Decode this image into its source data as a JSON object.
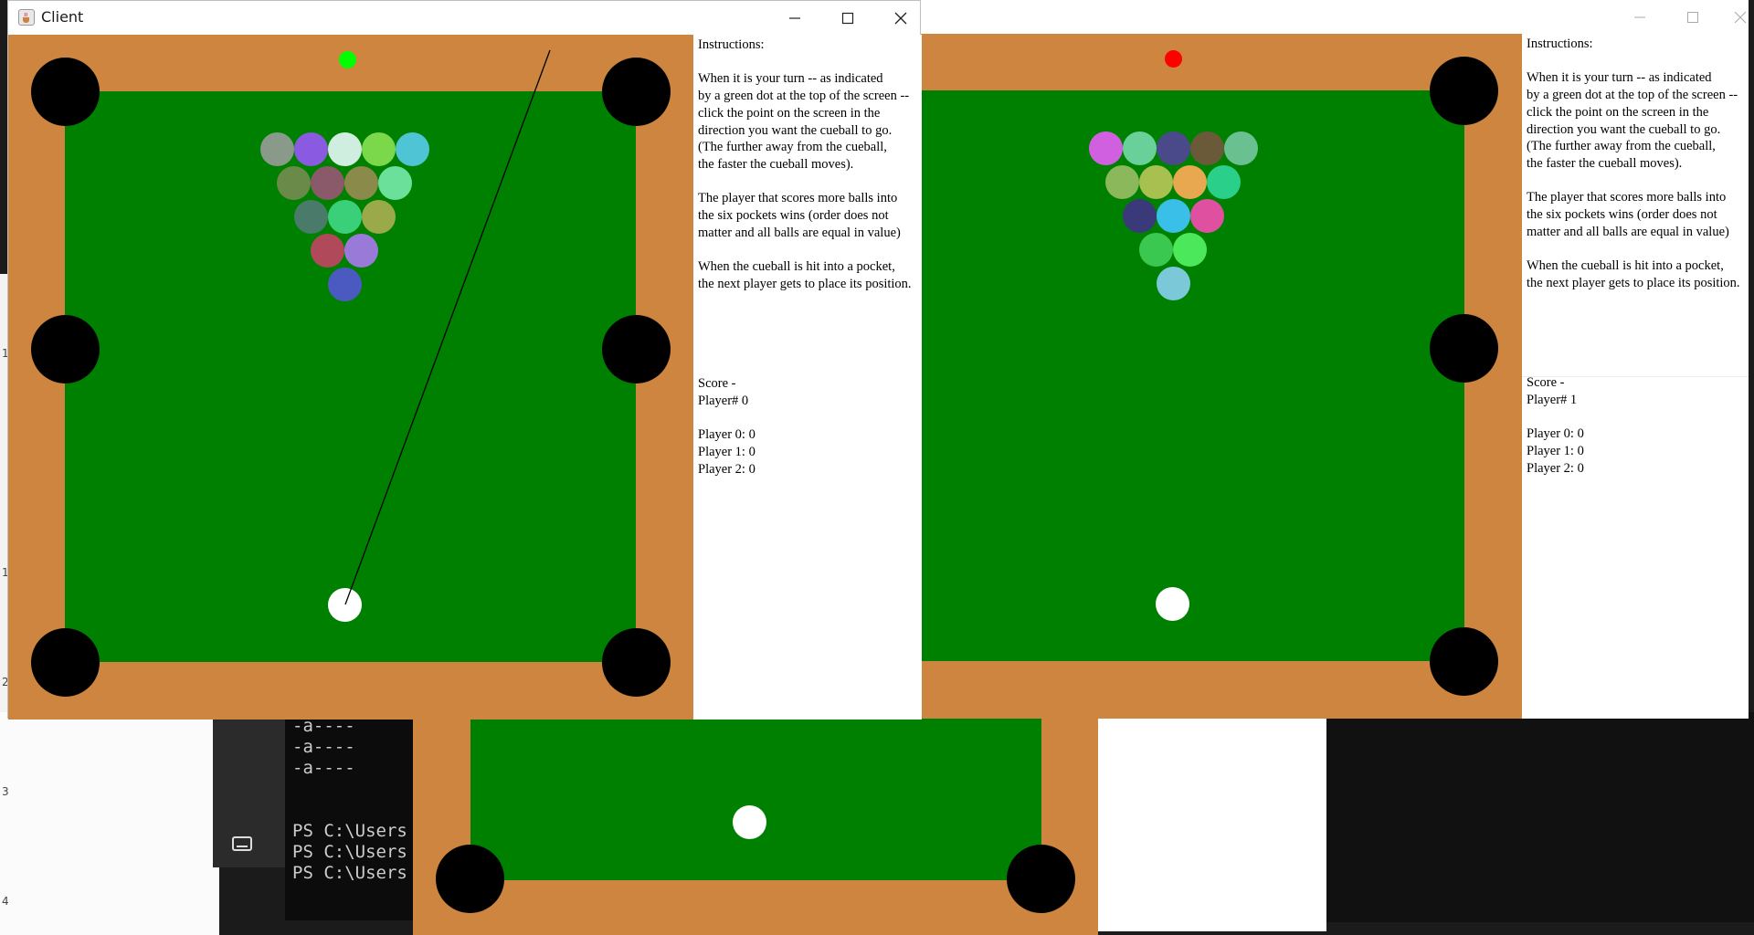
{
  "client_window": {
    "title": "Client",
    "icon": "java-cup-icon",
    "controls": [
      "minimize-icon",
      "maximize-icon",
      "close-icon"
    ],
    "turn_indicator_color": "#00ff00",
    "instructions_heading": "Instructions:",
    "instructions": [
      "When it is your turn -- as indicated",
      "by a green dot at the top of the screen --",
      "click the point on the screen in the",
      "direction you want the cueball to go.",
      "(The further away from the cueball,",
      "the faster the cueball moves).",
      "",
      "The player that scores more balls into",
      "the six pockets wins (order does not",
      "matter and all balls are equal in value)",
      "",
      "When the cueball is hit into a pocket,",
      "the next player gets to place its position."
    ],
    "score_heading": "Score -",
    "player_id": "Player# 0",
    "scores": [
      "Player 0: 0",
      "Player 1: 0",
      "Player 2: 0"
    ]
  },
  "second_window": {
    "controls": [
      "minimize-icon",
      "maximize-icon",
      "close-icon"
    ],
    "turn_indicator_color": "#ff0000",
    "instructions_heading": "Instructions:",
    "instructions": [
      "When it is your turn -- as indicated",
      "by a green dot at the top of the screen --",
      "click the point on the screen in the",
      "direction you want the cueball to go.",
      "(The further away from the cueball,",
      "the faster the cueball moves).",
      "",
      "The player that scores more balls into",
      "the six pockets wins (order does not",
      "matter and all balls are equal in value)",
      "",
      "When the cueball is hit into a pocket,",
      "the next player gets to place its position."
    ],
    "score_heading": "Score -",
    "player_id": "Player# 1",
    "scores": [
      "Player 0: 0",
      "Player 1: 0",
      "Player 2: 0"
    ]
  },
  "colors": {
    "table_wood": "#cd853f",
    "felt": "#008000",
    "pocket": "#000000",
    "cueball": "#ffffff"
  },
  "rack_1_colors": [
    "#8a9a8a",
    "#8a5ae0",
    "#cfeee0",
    "#7ad84a",
    "#4ec4d4",
    "#6a8a4a",
    "#8a5a6a",
    "#8a8a4a",
    "#6ae09a",
    "#4a7a6a",
    "#3ad07a",
    "#9aaa4a",
    "#b04a5a",
    "#9a7ad8",
    "#4a5ac0"
  ],
  "rack_2_colors": [
    "#d060e0",
    "#6ad09a",
    "#4a4a8a",
    "#6a5a3a",
    "#6ac090",
    "#8ab85a",
    "#a8c050",
    "#e8a850",
    "#2ad08a",
    "#3a3a7a",
    "#3ac0e8",
    "#e050a0",
    "#3ac850",
    "#4ae85a",
    "#7ac8d8"
  ],
  "background_terminal": {
    "lines": [
      "-a----",
      "-a----",
      "-a----",
      "",
      "",
      "PS C:\\Users",
      "PS C:\\Users",
      "PS C:\\Users"
    ]
  },
  "background_ruler": {
    "numbers": [
      "1",
      "1",
      "2",
      "3",
      "4"
    ]
  }
}
